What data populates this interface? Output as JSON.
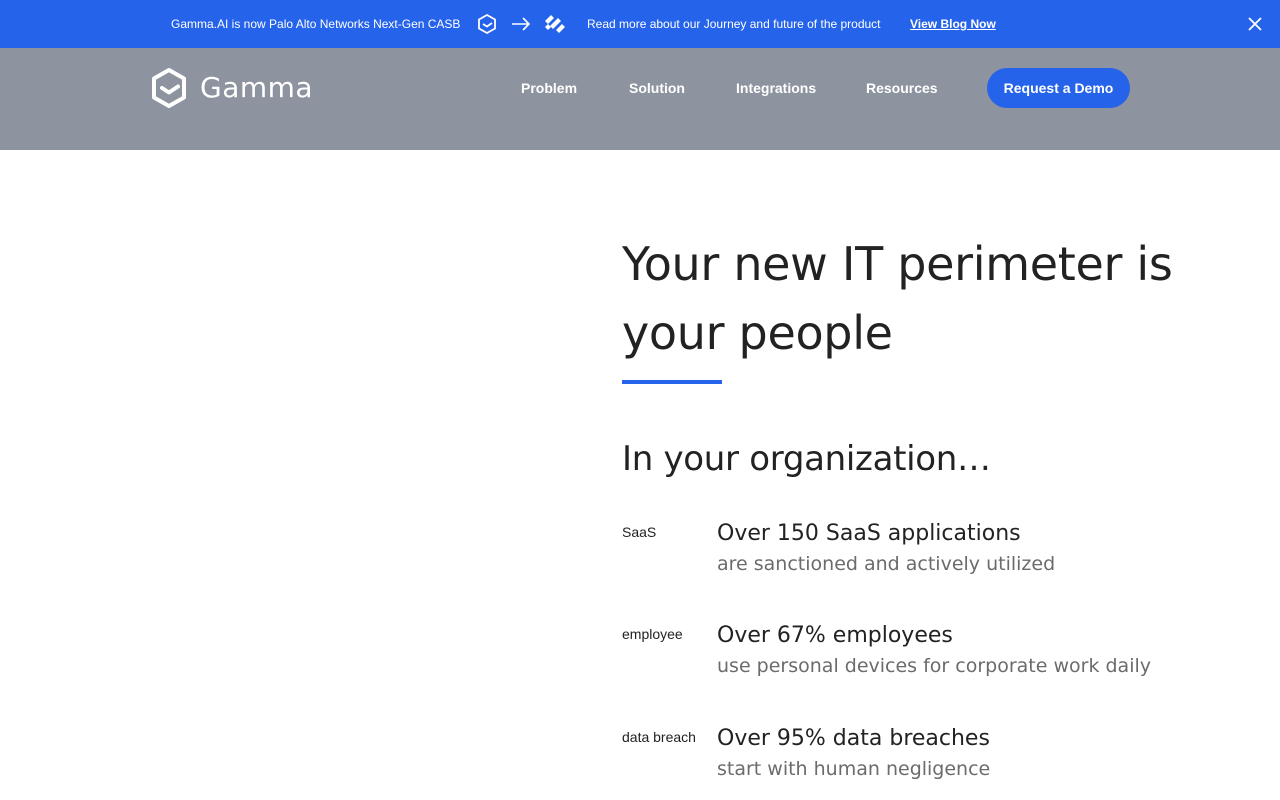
{
  "announcement": {
    "left_text": "Gamma.AI is now Palo Alto Networks Next-Gen CASB",
    "right_text": "Read more about our Journey and future of the product",
    "link_label": "View Blog Now",
    "icons": [
      "gamma-logo-icon",
      "arrow-right-icon",
      "palo-alto-logo-icon",
      "close-icon"
    ],
    "background": "#2563eb"
  },
  "nav": {
    "brand": "Gamma",
    "items": [
      {
        "label": "Problem"
      },
      {
        "label": "Solution"
      },
      {
        "label": "Integrations"
      },
      {
        "label": "Resources"
      }
    ],
    "cta_label": "Request a Demo",
    "background": "#8e949f",
    "accent": "#2563eb"
  },
  "hero": {
    "title": "Your new IT perimeter is your people",
    "subheading": "In your organization…"
  },
  "stats": [
    {
      "image_alt": "SaaS",
      "headline": "Over 150 SaaS applications",
      "detail": "are sanctioned and actively utilized"
    },
    {
      "image_alt": "employee",
      "headline": "Over 67% employees",
      "detail": "use personal devices for corporate work daily"
    },
    {
      "image_alt": "data breach",
      "headline": "Over 95% data breaches",
      "detail": "start with human negligence"
    }
  ]
}
